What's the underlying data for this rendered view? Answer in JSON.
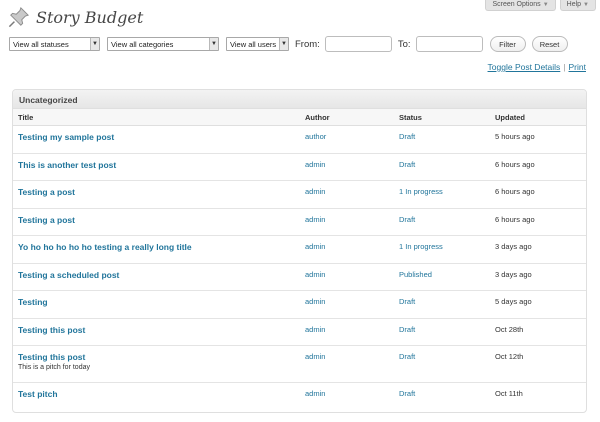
{
  "header_tabs": {
    "screen_options": "Screen Options",
    "help": "Help"
  },
  "page": {
    "title": "Story Budget"
  },
  "filters": {
    "status_select": "View all statuses",
    "category_select": "View all categories",
    "user_select": "View all users",
    "from_label": "From:",
    "from_value": "",
    "to_label": "To:",
    "to_value": "",
    "filter_button": "Filter",
    "reset_button": "Reset"
  },
  "links": {
    "toggle": "Toggle Post Details",
    "separator": "|",
    "print": "Print"
  },
  "panel": {
    "title": "Uncategorized",
    "columns": {
      "title": "Title",
      "author": "Author",
      "status": "Status",
      "updated": "Updated"
    },
    "rows": [
      {
        "title": "Testing my sample post",
        "author": "author",
        "status": "Draft",
        "updated": "5 hours ago"
      },
      {
        "title": "This is another test post",
        "author": "admin",
        "status": "Draft",
        "updated": "6 hours ago"
      },
      {
        "title": "Testing a post",
        "author": "admin",
        "status": "1 In progress",
        "updated": "6 hours ago"
      },
      {
        "title": "Testing a post",
        "author": "admin",
        "status": "Draft",
        "updated": "6 hours ago"
      },
      {
        "title": "Yo ho ho ho ho ho testing a really long title",
        "author": "admin",
        "status": "1 In progress",
        "updated": "3 days ago"
      },
      {
        "title": "Testing a scheduled post",
        "author": "admin",
        "status": "Published",
        "updated": "3 days ago"
      },
      {
        "title": "Testing",
        "author": "admin",
        "status": "Draft",
        "updated": "5 days ago"
      },
      {
        "title": "Testing this post",
        "author": "admin",
        "status": "Draft",
        "updated": "Oct 28th"
      },
      {
        "title": "Testing this post",
        "author": "admin",
        "status": "Draft",
        "updated": "Oct 12th",
        "pitch": "This is a pitch for today"
      },
      {
        "title": "Test pitch",
        "author": "admin",
        "status": "Draft",
        "updated": "Oct 11th"
      }
    ]
  },
  "colors": {
    "link": "#21759b",
    "header_bg": "#e6e6e6",
    "border": "#dfdfdf"
  },
  "icons": {
    "title_icon": "pushpin-icon"
  }
}
